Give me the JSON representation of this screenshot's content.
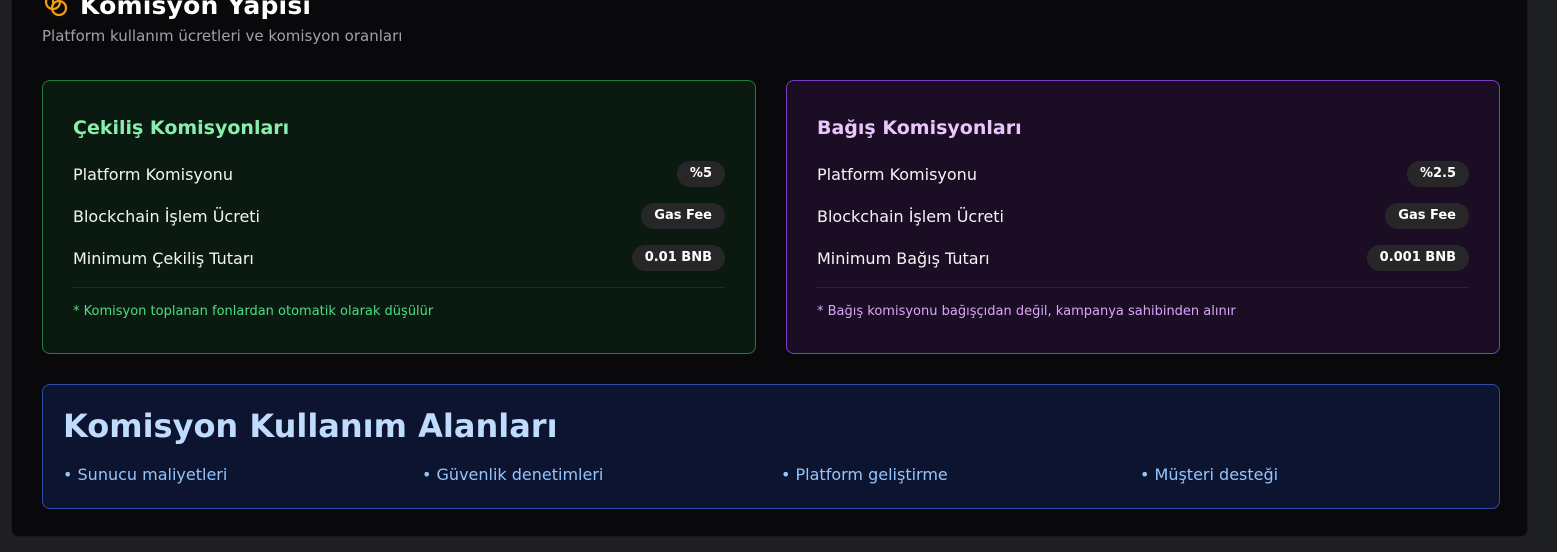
{
  "header": {
    "title": "Komisyon Yapısı",
    "subtitle": "Platform kullanım ücretleri ve komisyon oranları",
    "icon": "coins-icon",
    "icon_color": "#f59e0b"
  },
  "cekilis": {
    "title": "Çekiliş Komisyonları",
    "accent": "#86efac",
    "rows": [
      {
        "label": "Platform Komisyonu",
        "value": "%5"
      },
      {
        "label": "Blockchain İşlem Ücreti",
        "value": "Gas Fee"
      },
      {
        "label": "Minimum Çekiliş Tutarı",
        "value": "0.01 BNB"
      }
    ],
    "note": "* Komisyon toplanan fonlardan otomatik olarak düşülür"
  },
  "bagis": {
    "title": "Bağış Komisyonları",
    "accent": "#e9c6fb",
    "rows": [
      {
        "label": "Platform Komisyonu",
        "value": "%2.5"
      },
      {
        "label": "Blockchain İşlem Ücreti",
        "value": "Gas Fee"
      },
      {
        "label": "Minimum Bağış Tutarı",
        "value": "0.001 BNB"
      }
    ],
    "note": "* Bağış komisyonu bağışçıdan değil, kampanya sahibinden alınır"
  },
  "usage": {
    "title": "Komisyon Kullanım Alanları",
    "items": [
      "• Sunucu maliyetleri",
      "• Güvenlik denetimleri",
      "• Platform geliştirme",
      "• Müşteri desteği"
    ]
  }
}
